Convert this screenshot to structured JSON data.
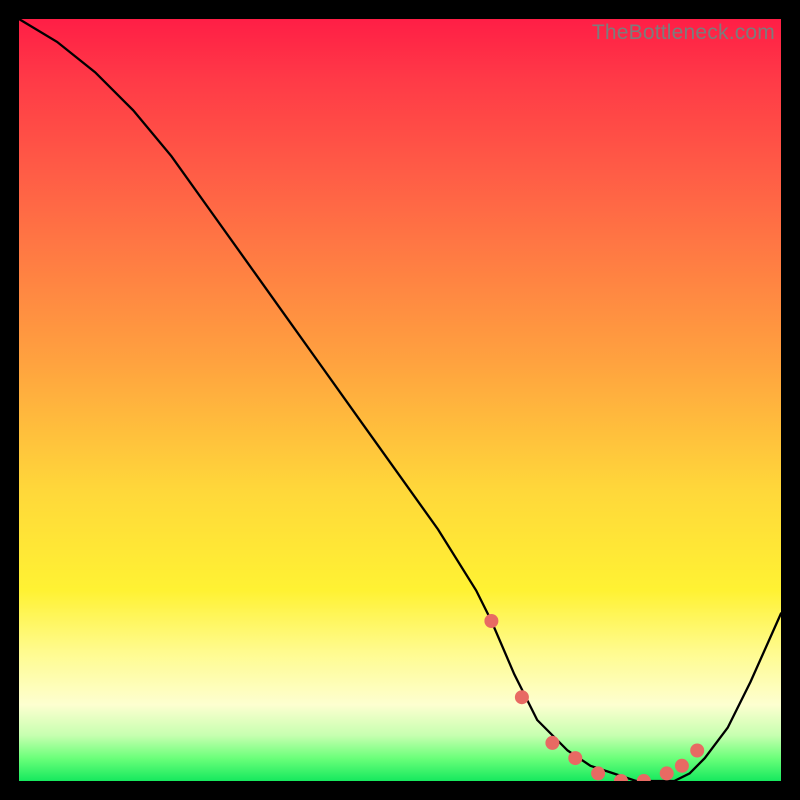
{
  "watermark": "TheBottleneck.com",
  "colors": {
    "gradient_top": "#ff1e46",
    "gradient_mid1": "#ff6a45",
    "gradient_mid2": "#ffd83a",
    "gradient_mid3": "#fffb8e",
    "gradient_bottom": "#16e95e",
    "dot": "#e86a63",
    "curve": "#000000",
    "frame": "#000000"
  },
  "chart_data": {
    "type": "line",
    "title": "",
    "xlabel": "",
    "ylabel": "",
    "xlim": [
      0,
      100
    ],
    "ylim": [
      0,
      100
    ],
    "series": [
      {
        "name": "bottleneck-curve",
        "x": [
          0,
          5,
          10,
          15,
          20,
          25,
          30,
          35,
          40,
          45,
          50,
          55,
          60,
          62,
          65,
          68,
          72,
          75,
          78,
          81,
          84,
          86,
          88,
          90,
          93,
          96,
          100
        ],
        "values": [
          100,
          97,
          93,
          88,
          82,
          75,
          68,
          61,
          54,
          47,
          40,
          33,
          25,
          21,
          14,
          8,
          4,
          2,
          1,
          0,
          0,
          0,
          1,
          3,
          7,
          13,
          22
        ]
      }
    ],
    "dots": {
      "name": "highlighted-range",
      "x": [
        62,
        66,
        70,
        73,
        76,
        79,
        82,
        85,
        87,
        89
      ],
      "values": [
        21,
        11,
        5,
        3,
        1,
        0,
        0,
        1,
        2,
        4
      ]
    }
  }
}
